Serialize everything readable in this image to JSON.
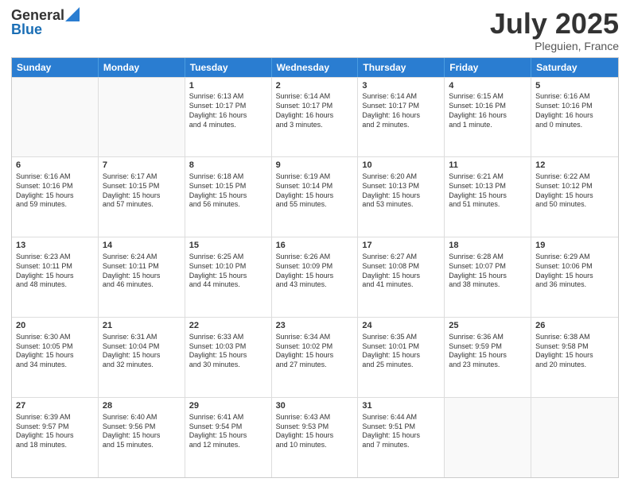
{
  "logo": {
    "general": "General",
    "blue": "Blue"
  },
  "title": "July 2025",
  "subtitle": "Pleguien, France",
  "header": {
    "days": [
      "Sunday",
      "Monday",
      "Tuesday",
      "Wednesday",
      "Thursday",
      "Friday",
      "Saturday"
    ]
  },
  "weeks": [
    [
      {
        "day": "",
        "info": ""
      },
      {
        "day": "",
        "info": ""
      },
      {
        "day": "1",
        "info": "Sunrise: 6:13 AM\nSunset: 10:17 PM\nDaylight: 16 hours\nand 4 minutes."
      },
      {
        "day": "2",
        "info": "Sunrise: 6:14 AM\nSunset: 10:17 PM\nDaylight: 16 hours\nand 3 minutes."
      },
      {
        "day": "3",
        "info": "Sunrise: 6:14 AM\nSunset: 10:17 PM\nDaylight: 16 hours\nand 2 minutes."
      },
      {
        "day": "4",
        "info": "Sunrise: 6:15 AM\nSunset: 10:16 PM\nDaylight: 16 hours\nand 1 minute."
      },
      {
        "day": "5",
        "info": "Sunrise: 6:16 AM\nSunset: 10:16 PM\nDaylight: 16 hours\nand 0 minutes."
      }
    ],
    [
      {
        "day": "6",
        "info": "Sunrise: 6:16 AM\nSunset: 10:16 PM\nDaylight: 15 hours\nand 59 minutes."
      },
      {
        "day": "7",
        "info": "Sunrise: 6:17 AM\nSunset: 10:15 PM\nDaylight: 15 hours\nand 57 minutes."
      },
      {
        "day": "8",
        "info": "Sunrise: 6:18 AM\nSunset: 10:15 PM\nDaylight: 15 hours\nand 56 minutes."
      },
      {
        "day": "9",
        "info": "Sunrise: 6:19 AM\nSunset: 10:14 PM\nDaylight: 15 hours\nand 55 minutes."
      },
      {
        "day": "10",
        "info": "Sunrise: 6:20 AM\nSunset: 10:13 PM\nDaylight: 15 hours\nand 53 minutes."
      },
      {
        "day": "11",
        "info": "Sunrise: 6:21 AM\nSunset: 10:13 PM\nDaylight: 15 hours\nand 51 minutes."
      },
      {
        "day": "12",
        "info": "Sunrise: 6:22 AM\nSunset: 10:12 PM\nDaylight: 15 hours\nand 50 minutes."
      }
    ],
    [
      {
        "day": "13",
        "info": "Sunrise: 6:23 AM\nSunset: 10:11 PM\nDaylight: 15 hours\nand 48 minutes."
      },
      {
        "day": "14",
        "info": "Sunrise: 6:24 AM\nSunset: 10:11 PM\nDaylight: 15 hours\nand 46 minutes."
      },
      {
        "day": "15",
        "info": "Sunrise: 6:25 AM\nSunset: 10:10 PM\nDaylight: 15 hours\nand 44 minutes."
      },
      {
        "day": "16",
        "info": "Sunrise: 6:26 AM\nSunset: 10:09 PM\nDaylight: 15 hours\nand 43 minutes."
      },
      {
        "day": "17",
        "info": "Sunrise: 6:27 AM\nSunset: 10:08 PM\nDaylight: 15 hours\nand 41 minutes."
      },
      {
        "day": "18",
        "info": "Sunrise: 6:28 AM\nSunset: 10:07 PM\nDaylight: 15 hours\nand 38 minutes."
      },
      {
        "day": "19",
        "info": "Sunrise: 6:29 AM\nSunset: 10:06 PM\nDaylight: 15 hours\nand 36 minutes."
      }
    ],
    [
      {
        "day": "20",
        "info": "Sunrise: 6:30 AM\nSunset: 10:05 PM\nDaylight: 15 hours\nand 34 minutes."
      },
      {
        "day": "21",
        "info": "Sunrise: 6:31 AM\nSunset: 10:04 PM\nDaylight: 15 hours\nand 32 minutes."
      },
      {
        "day": "22",
        "info": "Sunrise: 6:33 AM\nSunset: 10:03 PM\nDaylight: 15 hours\nand 30 minutes."
      },
      {
        "day": "23",
        "info": "Sunrise: 6:34 AM\nSunset: 10:02 PM\nDaylight: 15 hours\nand 27 minutes."
      },
      {
        "day": "24",
        "info": "Sunrise: 6:35 AM\nSunset: 10:01 PM\nDaylight: 15 hours\nand 25 minutes."
      },
      {
        "day": "25",
        "info": "Sunrise: 6:36 AM\nSunset: 9:59 PM\nDaylight: 15 hours\nand 23 minutes."
      },
      {
        "day": "26",
        "info": "Sunrise: 6:38 AM\nSunset: 9:58 PM\nDaylight: 15 hours\nand 20 minutes."
      }
    ],
    [
      {
        "day": "27",
        "info": "Sunrise: 6:39 AM\nSunset: 9:57 PM\nDaylight: 15 hours\nand 18 minutes."
      },
      {
        "day": "28",
        "info": "Sunrise: 6:40 AM\nSunset: 9:56 PM\nDaylight: 15 hours\nand 15 minutes."
      },
      {
        "day": "29",
        "info": "Sunrise: 6:41 AM\nSunset: 9:54 PM\nDaylight: 15 hours\nand 12 minutes."
      },
      {
        "day": "30",
        "info": "Sunrise: 6:43 AM\nSunset: 9:53 PM\nDaylight: 15 hours\nand 10 minutes."
      },
      {
        "day": "31",
        "info": "Sunrise: 6:44 AM\nSunset: 9:51 PM\nDaylight: 15 hours\nand 7 minutes."
      },
      {
        "day": "",
        "info": ""
      },
      {
        "day": "",
        "info": ""
      }
    ]
  ]
}
